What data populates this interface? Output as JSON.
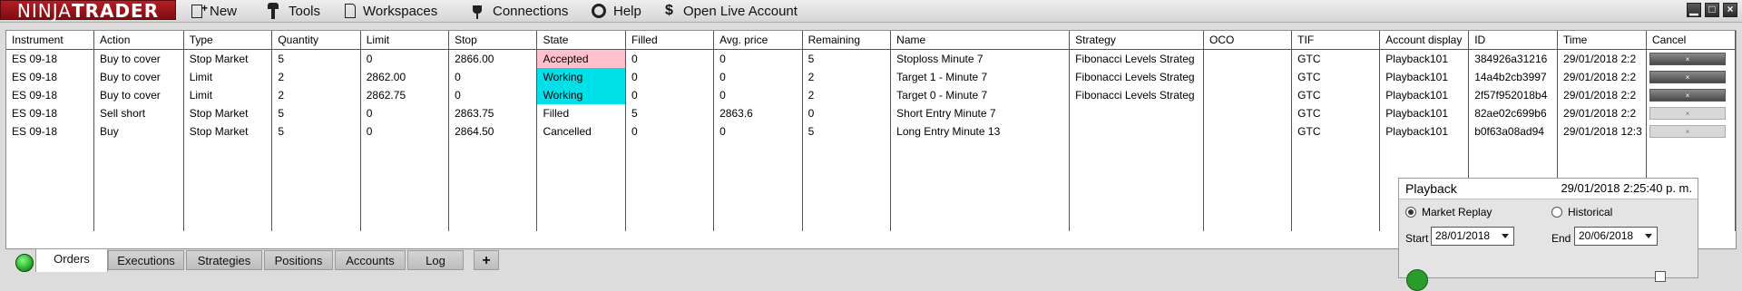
{
  "brand": {
    "part1": "NINJA",
    "part2": "TRADER"
  },
  "menu": [
    {
      "label": "New",
      "icon": "new-window-icon"
    },
    {
      "label": "Tools",
      "icon": "tools-icon"
    },
    {
      "label": "Workspaces",
      "icon": "document-icon"
    },
    {
      "label": "Connections",
      "icon": "plug-icon"
    },
    {
      "label": "Help",
      "icon": "lifebuoy-icon"
    },
    {
      "label": "Open Live Account",
      "icon": "dollar-icon"
    }
  ],
  "window_controls": {
    "minimize": "▁",
    "maximize": "□",
    "close": "×"
  },
  "columns": [
    "Instrument",
    "Action",
    "Type",
    "Quantity",
    "Limit",
    "Stop",
    "State",
    "Filled",
    "Avg. price",
    "Remaining",
    "Name",
    "Strategy",
    "OCO",
    "TIF",
    "Account display",
    "ID",
    "Time",
    "Cancel"
  ],
  "orders": [
    [
      "ES 09-18",
      "Buy to cover",
      "Stop Market",
      "5",
      "0",
      "2866.00",
      "Accepted",
      "0",
      "0",
      "5",
      "Stoploss Minute 7",
      "Fibonacci Levels Strateg",
      "",
      "GTC",
      "Playback101",
      "384926a31216",
      "29/01/2018 2:2"
    ],
    [
      "ES 09-18",
      "Buy to cover",
      "Limit",
      "2",
      "2862.00",
      "0",
      "Working",
      "0",
      "0",
      "2",
      "Target 1 - Minute 7",
      "Fibonacci Levels Strateg",
      "",
      "GTC",
      "Playback101",
      "14a4b2cb3997",
      "29/01/2018 2:2"
    ],
    [
      "ES 09-18",
      "Buy to cover",
      "Limit",
      "2",
      "2862.75",
      "0",
      "Working",
      "0",
      "0",
      "2",
      "Target 0 - Minute 7",
      "Fibonacci Levels Strateg",
      "",
      "GTC",
      "Playback101",
      "2f57f952018b4",
      "29/01/2018 2:2"
    ],
    [
      "ES 09-18",
      "Sell short",
      "Stop Market",
      "5",
      "0",
      "2863.75",
      "Filled",
      "5",
      "2863.6",
      "0",
      "Short Entry Minute 7",
      "",
      "",
      "GTC",
      "Playback101",
      "82ae02c699b6",
      "29/01/2018 2:2"
    ],
    [
      "ES 09-18",
      "Buy",
      "Stop Market",
      "5",
      "0",
      "2864.50",
      "Cancelled",
      "0",
      "0",
      "5",
      "Long Entry Minute 13",
      "",
      "",
      "GTC",
      "Playback101",
      "b0f63a08ad94",
      "29/01/2018 12:3"
    ]
  ],
  "cancel_glyph": "×",
  "state_colors": {
    "Accepted": "#ffc0cb",
    "Working": "#00e0e8"
  },
  "tabs": [
    "Orders",
    "Executions",
    "Strategies",
    "Positions",
    "Accounts",
    "Log",
    "+"
  ],
  "active_tab": "Orders",
  "playback": {
    "title": "Playback",
    "time": "29/01/2018 2:25:40 p. m.",
    "mode_market_replay": "Market Replay",
    "mode_historical": "Historical",
    "selected_mode": "Market Replay",
    "start_label": "Start",
    "start_date": "28/01/2018",
    "end_label": "End",
    "end_date": "20/06/2018"
  }
}
